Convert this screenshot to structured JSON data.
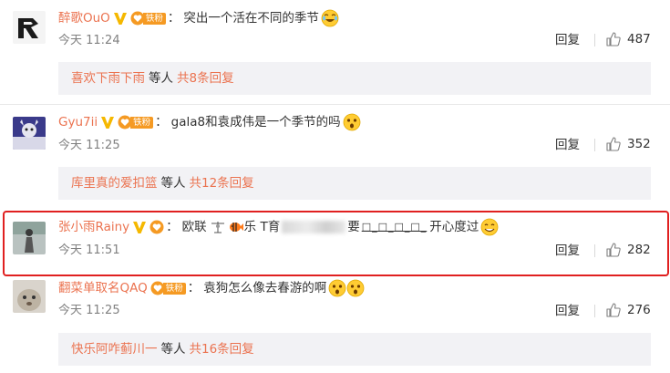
{
  "comments": [
    {
      "username": "醉歌OuO",
      "fan_label": "铁粉",
      "text": "突出一个活在不同的季节",
      "emoji": "laugh-cry-emoji",
      "time": "今天 11:24",
      "reply_label": "回复",
      "likes": "487",
      "sub": {
        "user": "喜欢下雨下雨",
        "others": "等人",
        "total": "共8条回复"
      }
    },
    {
      "username": "Gyu7ii",
      "fan_label": "铁粉",
      "text": "gala8和袁成伟是一个季节的吗",
      "emoji": "shocked-emoji",
      "time": "今天 11:25",
      "reply_label": "回复",
      "likes": "352",
      "sub": {
        "user": "库里真的爱扣篮",
        "others": "等人",
        "total": "共12条回复"
      }
    },
    {
      "username": "张小雨Rainy",
      "text_a": "欧联",
      "text_b": "乐 T育",
      "text_c": "要",
      "text_d": "□_□_□_□_",
      "text_e": "开心度过",
      "emoji": "smile-emoji",
      "time": "今天 11:51",
      "reply_label": "回复",
      "likes": "282"
    },
    {
      "username": "翻菜单取名QAQ",
      "fan_label": "铁粉",
      "text": "袁狗怎么像去春游的啊",
      "emoji": "shocked-emoji",
      "time": "今天 11:25",
      "reply_label": "回复",
      "likes": "276",
      "sub": {
        "user": "快乐阿咋蓟川一",
        "others": "等人",
        "total": "共16条回复"
      }
    }
  ],
  "colon": "：",
  "colors": {
    "username": "#eb7350",
    "highlight": "#e02020",
    "fan_badge": "#f59a23"
  }
}
